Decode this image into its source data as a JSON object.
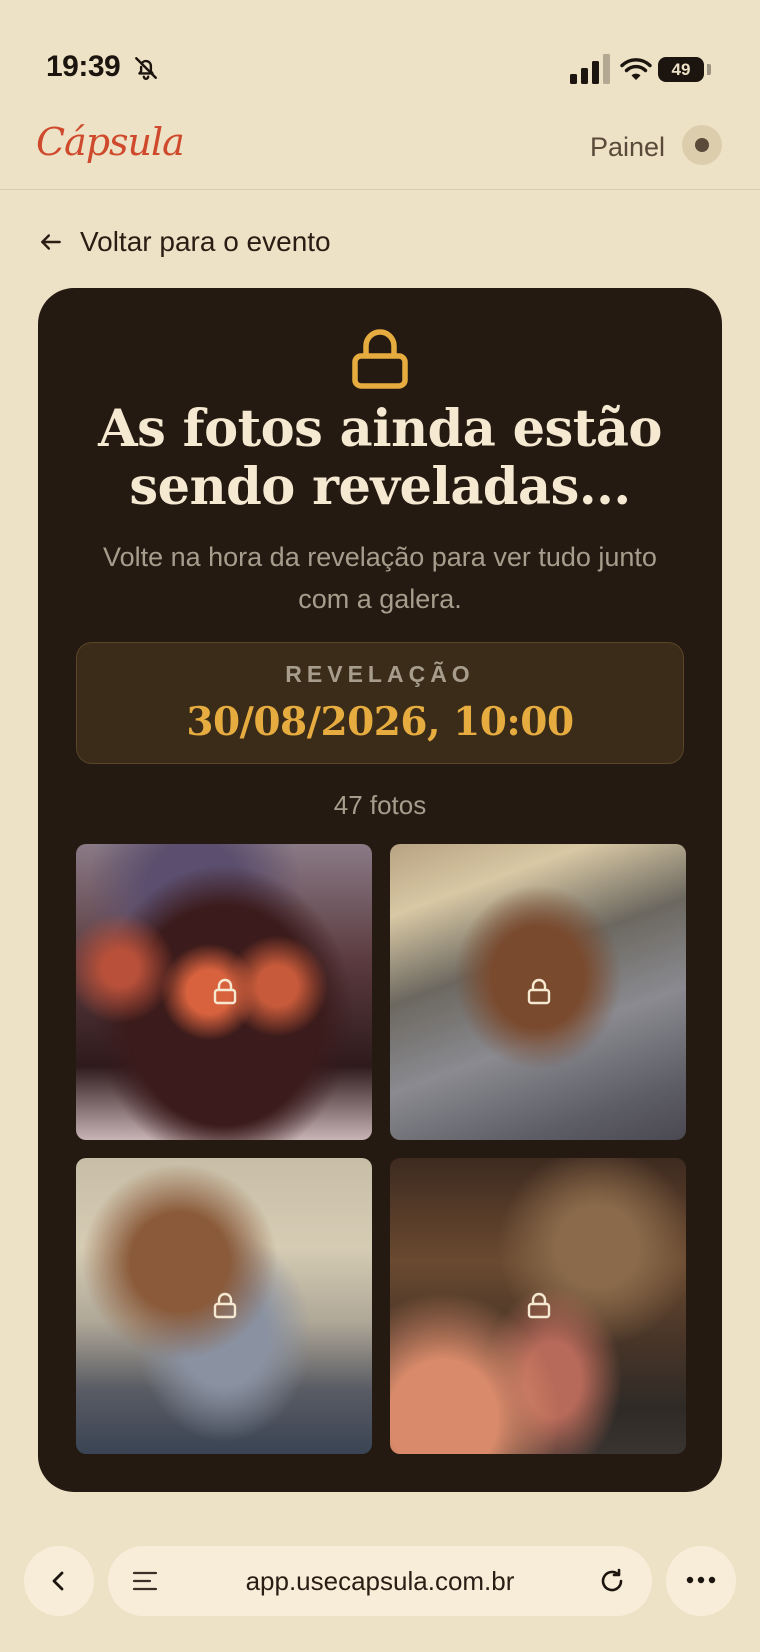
{
  "status_bar": {
    "time": "19:39",
    "battery": "49",
    "icons": [
      "bell-off-icon",
      "cellular-signal-icon",
      "wifi-icon",
      "battery-icon"
    ]
  },
  "header": {
    "logo": "Cápsula",
    "painel_label": "Painel"
  },
  "back_link": {
    "label": "Voltar para o evento"
  },
  "card": {
    "title_line1": "As fotos ainda estão",
    "title_line2": "sendo reveladas...",
    "subtitle_line1": "Volte na hora da revelação para ver tudo junto",
    "subtitle_line2": "com a galera.",
    "reveal_label": "REVELAÇÃO",
    "reveal_date": "30/08/2026, 10:00",
    "photo_count": "47 fotos",
    "photos": [
      {
        "locked": true
      },
      {
        "locked": true
      },
      {
        "locked": true
      },
      {
        "locked": true
      }
    ]
  },
  "browser": {
    "url": "app.usecapsula.com.br"
  },
  "colors": {
    "background": "#ede1c6",
    "card": "#241a12",
    "accent": "#e6ac3f",
    "logo": "#cf4a2c"
  }
}
